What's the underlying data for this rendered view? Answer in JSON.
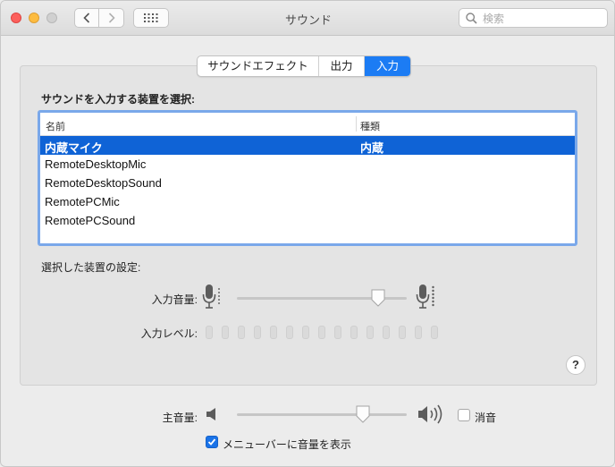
{
  "window": {
    "title": "サウンド"
  },
  "search": {
    "placeholder": "検索",
    "value": ""
  },
  "tabs": [
    {
      "label": "サウンドエフェクト",
      "active": false
    },
    {
      "label": "出力",
      "active": false
    },
    {
      "label": "入力",
      "active": true
    }
  ],
  "input_section": {
    "title": "サウンドを入力する装置を選択:",
    "columns": [
      "名前",
      "種類"
    ],
    "devices": [
      {
        "name": "内蔵マイク",
        "type": "内蔵",
        "selected": true
      },
      {
        "name": "RemoteDesktopMic",
        "type": "",
        "selected": false
      },
      {
        "name": "RemoteDesktopSound",
        "type": "",
        "selected": false
      },
      {
        "name": "RemotePCMic",
        "type": "",
        "selected": false
      },
      {
        "name": "RemotePCSound",
        "type": "",
        "selected": false
      }
    ],
    "settings_title": "選択した装置の設定:",
    "input_volume_label": "入力音量:",
    "input_volume_value": 0.83,
    "input_level_label": "入力レベル:",
    "input_level_bars": 15,
    "input_level_active": 0
  },
  "output_volume": {
    "label": "主音量:",
    "value": 0.74,
    "mute_label": "消音",
    "mute_checked": false
  },
  "menubar_option": {
    "label": "メニューバーに音量を表示",
    "checked": true
  },
  "help_label": "?",
  "colors": {
    "accent": "#1c7cf4",
    "selection": "#0f63d6",
    "focus_ring": "#7aa8ea"
  }
}
